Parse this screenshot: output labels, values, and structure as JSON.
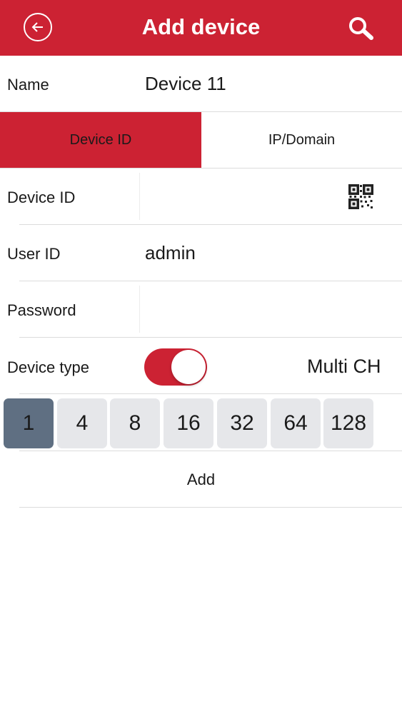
{
  "header": {
    "title": "Add device",
    "back_icon": "back-arrow-circle-icon",
    "search_icon": "search-icon",
    "background_color": "#cc2233"
  },
  "form": {
    "name_label": "Name",
    "name_value": "Device 11",
    "mode_tabs": [
      {
        "label": "Device ID",
        "active": true
      },
      {
        "label": "IP/Domain",
        "active": false
      }
    ],
    "device_id_label": "Device ID",
    "device_id_value": "",
    "qr_icon": "qr-code-icon",
    "user_id_label": "User ID",
    "user_id_value": "admin",
    "password_label": "Password",
    "password_value": "",
    "device_type_label": "Device type",
    "device_type_toggle_on": true,
    "device_type_value": "Multi CH",
    "channels": [
      "1",
      "4",
      "8",
      "16",
      "32",
      "64",
      "128"
    ],
    "selected_channel": "1",
    "add_label": "Add"
  },
  "colors": {
    "accent": "#cc2233",
    "selected_channel_bg": "#5f6f82",
    "channel_bg": "#e6e7ea"
  }
}
